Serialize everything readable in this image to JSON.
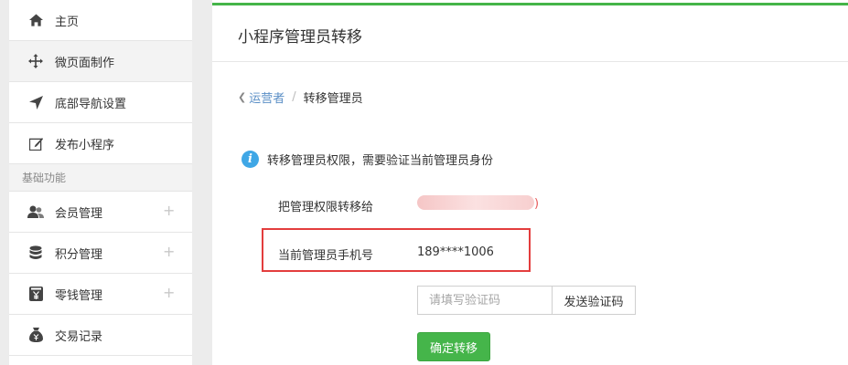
{
  "sidebar": {
    "items_top": [
      {
        "label": "主页",
        "icon": "home-icon"
      },
      {
        "label": "微页面制作",
        "icon": "move-icon"
      },
      {
        "label": "底部导航设置",
        "icon": "navigation-arrow-icon"
      },
      {
        "label": "发布小程序",
        "icon": "edit-icon"
      }
    ],
    "section_title": "基础功能",
    "items_basic": [
      {
        "label": "会员管理",
        "icon": "users-icon",
        "expand": "+"
      },
      {
        "label": "积分管理",
        "icon": "database-icon",
        "expand": "+"
      },
      {
        "label": "零钱管理",
        "icon": "yen-wallet-icon",
        "expand": "+"
      },
      {
        "label": "交易记录",
        "icon": "money-bag-icon"
      }
    ]
  },
  "main": {
    "page_title": "小程序管理员转移",
    "breadcrumb": {
      "back": "❮",
      "parent": "运营者",
      "separator": "/",
      "current": "转移管理员"
    },
    "notice": {
      "icon_glyph": "i",
      "text": "转移管理员权限，需要验证当前管理员身份"
    },
    "transfer": {
      "label": "把管理权限转移给",
      "suffix": ")"
    },
    "phone": {
      "label": "当前管理员手机号",
      "value": "189****1006"
    },
    "code_input": {
      "value": "",
      "placeholder": "请填写验证码"
    },
    "send_code_label": "发送验证码",
    "confirm_label": "确定转移"
  },
  "colors": {
    "accent": "#44b549",
    "highlight": "#e33d3d",
    "link": "#5b8fc6",
    "info": "#3fa7e6"
  }
}
